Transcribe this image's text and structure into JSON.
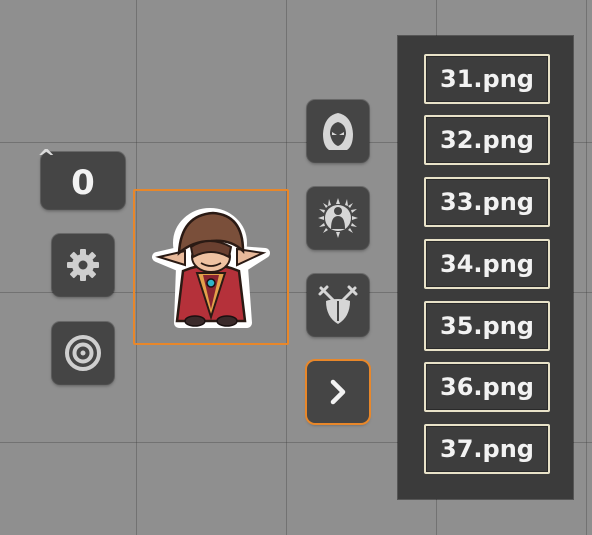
{
  "hud": {
    "elevation_caret": "^",
    "elevation_value": "0"
  },
  "left_buttons": [
    {
      "icon": "gear-icon"
    },
    {
      "icon": "target-icon"
    }
  ],
  "token": {
    "icon": "elf-character-token",
    "selected": true
  },
  "class_buttons": [
    {
      "icon": "hooded-rogue-icon"
    },
    {
      "icon": "radiant-priest-icon"
    },
    {
      "icon": "crossed-swords-shield-icon"
    }
  ],
  "expand_button": {
    "icon": "chevron-right-icon",
    "active": true
  },
  "file_list": [
    "31.png",
    "32.png",
    "33.png",
    "34.png",
    "35.png",
    "36.png",
    "37.png"
  ],
  "colors": {
    "accent": "#e8872a",
    "button_bg": "#454545",
    "panel_bg": "#3b3b3b",
    "file_border": "#e8e2c8",
    "grid_bg": "#8f8f8f"
  }
}
